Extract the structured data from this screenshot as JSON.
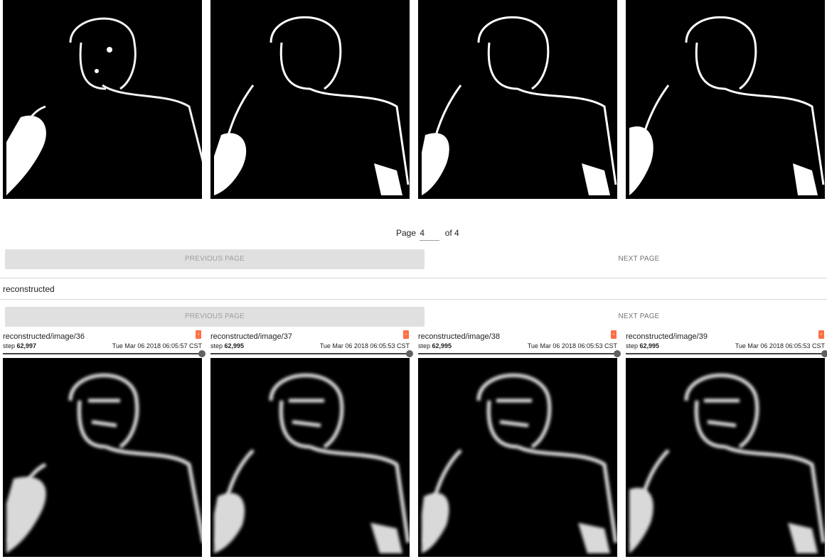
{
  "pagination": {
    "page_label": "Page",
    "current_page": "4",
    "of_label": "of 4",
    "previous_label": "PREVIOUS PAGE",
    "next_label": "NEXT PAGE"
  },
  "group": {
    "name": "reconstructed"
  },
  "cards": [
    {
      "title": "reconstructed/image/36",
      "step_label": "step",
      "step": "62,997",
      "timestamp": "Tue Mar 06 2018 06:05:57 CST",
      "badge": "-"
    },
    {
      "title": "reconstructed/image/37",
      "step_label": "step",
      "step": "62,995",
      "timestamp": "Tue Mar 06 2018 06:05:53 CST",
      "badge": "-"
    },
    {
      "title": "reconstructed/image/38",
      "step_label": "step",
      "step": "62,995",
      "timestamp": "Tue Mar 06 2018 06:05:53 CST",
      "badge": "-"
    },
    {
      "title": "reconstructed/image/39",
      "step_label": "step",
      "step": "62,995",
      "timestamp": "Tue Mar 06 2018 06:05:53 CST",
      "badge": "-"
    }
  ],
  "colors": {
    "accent_badge": "#ff7043",
    "button_disabled_bg": "#e0e0e0",
    "image_bg": "#000000"
  }
}
